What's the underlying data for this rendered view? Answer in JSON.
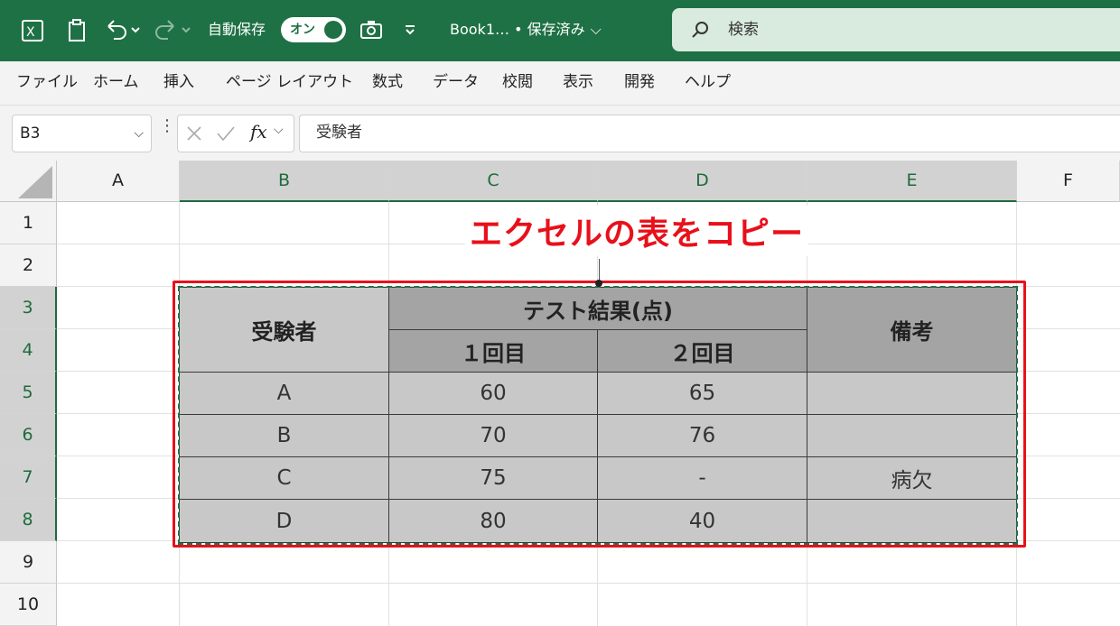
{
  "titlebar": {
    "autosave_label": "自動保存",
    "autosave_state": "オン",
    "doc_title": "Book1… • 保存済み",
    "search_placeholder": "検索"
  },
  "menu": [
    "ファイル",
    "ホーム",
    "挿入",
    "ページ レイアウト",
    "数式",
    "データ",
    "校閲",
    "表示",
    "開発",
    "ヘルプ"
  ],
  "formula_bar": {
    "name_box": "B3",
    "fx": "fx",
    "formula": "受験者"
  },
  "columns": [
    "A",
    "B",
    "C",
    "D",
    "E",
    "F"
  ],
  "rows": [
    "1",
    "2",
    "3",
    "4",
    "5",
    "6",
    "7",
    "8",
    "9",
    "10"
  ],
  "callout": "エクセルの表をコピー",
  "table": {
    "header_examinee": "受験者",
    "header_test": "テスト結果(点)",
    "header_1st": "１回目",
    "header_2nd": "２回目",
    "header_note": "備考",
    "data": [
      [
        "A",
        "60",
        "65",
        ""
      ],
      [
        "B",
        "70",
        "76",
        ""
      ],
      [
        "C",
        "75",
        "-",
        "病欠"
      ],
      [
        "D",
        "80",
        "40",
        ""
      ]
    ]
  },
  "colors": {
    "brand": "#1e7145",
    "highlight": "#e8101a"
  }
}
